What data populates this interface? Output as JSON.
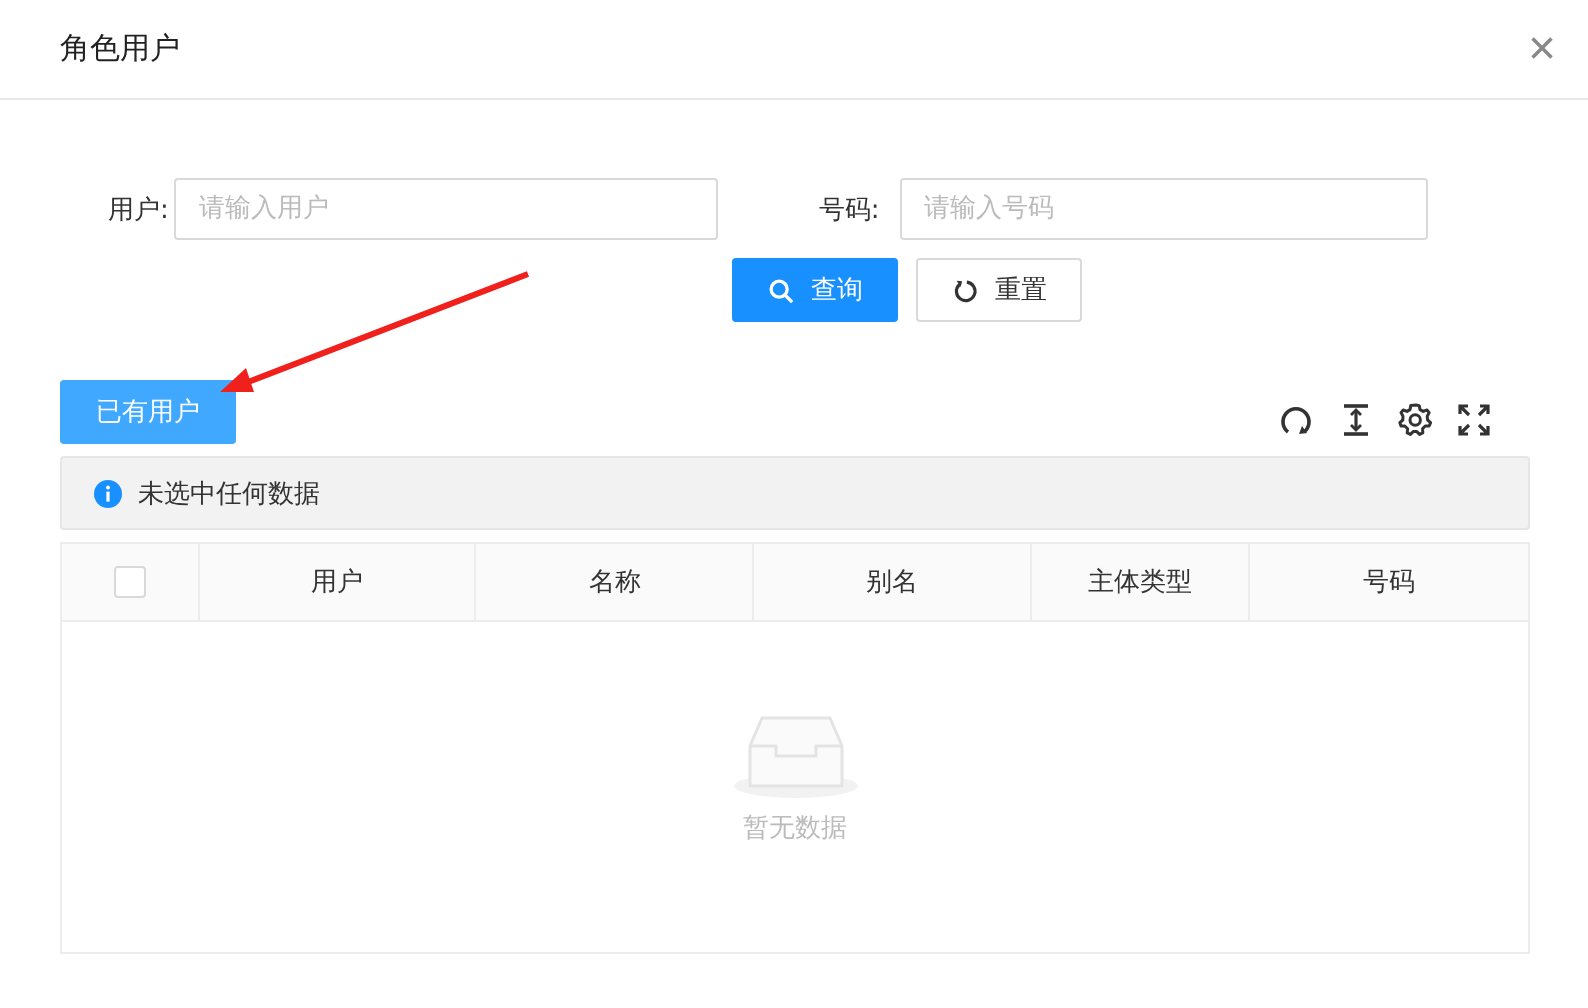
{
  "dialog": {
    "title": "角色用户",
    "close": "×"
  },
  "filters": [
    {
      "label": "用户:",
      "placeholder": "请输入用户"
    },
    {
      "label": "号码:",
      "placeholder": "请输入号码"
    }
  ],
  "buttons": [
    {
      "kind": "search",
      "label": "查询"
    },
    {
      "kind": "reset",
      "label": "重置"
    }
  ],
  "existing_button": "已有用户",
  "alert": "未选中任何数据",
  "table": {
    "select_all": {
      "checked": false
    },
    "columns": [
      "用户",
      "名称",
      "别名",
      "主体类型",
      "号码"
    ],
    "empty_text": "暂无数据"
  }
}
